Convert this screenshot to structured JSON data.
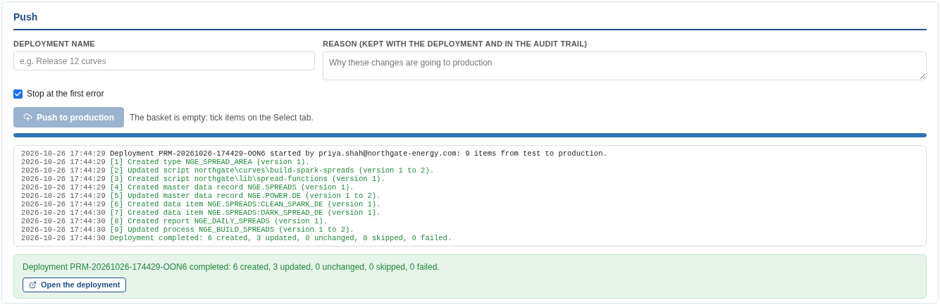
{
  "title": "Push",
  "form": {
    "name_label": "DEPLOYMENT NAME",
    "name_placeholder": "e.g. Release 12 curves",
    "reason_label": "REASON (KEPT WITH THE DEPLOYMENT AND IN THE AUDIT TRAIL)",
    "reason_placeholder": "Why these changes are going to production"
  },
  "stop_on_error": {
    "label": "Stop at the first error",
    "checked": true
  },
  "push_button": {
    "label": "Push to production",
    "disabled": true
  },
  "hint": "The basket is empty: tick items on the Select tab.",
  "progress": {
    "level": 1
  },
  "log": [
    {
      "time": "2026-10-26 17:44:29",
      "message": "Deployment PRM-20261026-174429-OON6 started by priya.shah@northgate-energy.com: 9 items from test to production.",
      "kind": "info"
    },
    {
      "time": "2026-10-26 17:44:29",
      "message": "[1] Created type NGE_SPREAD_AREA (version 1).",
      "kind": "success"
    },
    {
      "time": "2026-10-26 17:44:29",
      "message": "[2] Updated script northgate\\curves\\build-spark-spreads (version 1 to 2).",
      "kind": "success"
    },
    {
      "time": "2026-10-26 17:44:29",
      "message": "[3] Created script northgate\\lib\\spread-functions (version 1).",
      "kind": "success"
    },
    {
      "time": "2026-10-26 17:44:29",
      "message": "[4] Created master data record NGE.SPREADS (version 1).",
      "kind": "success"
    },
    {
      "time": "2026-10-26 17:44:29",
      "message": "[5] Updated master data record NGE.POWER.DE (version 1 to 2).",
      "kind": "success"
    },
    {
      "time": "2026-10-26 17:44:29",
      "message": "[6] Created data item NGE.SPREADS:CLEAN_SPARK_DE (version 1).",
      "kind": "success"
    },
    {
      "time": "2026-10-26 17:44:30",
      "message": "[7] Created data item NGE.SPREADS:DARK_SPREAD_DE (version 1).",
      "kind": "success"
    },
    {
      "time": "2026-10-26 17:44:30",
      "message": "[8] Created report NGE_DAILY_SPREADS (version 1).",
      "kind": "success"
    },
    {
      "time": "2026-10-26 17:44:30",
      "message": "[9] Updated process NGE_BUILD_SPREADS (version 1 to 2).",
      "kind": "success"
    },
    {
      "time": "2026-10-26 17:44:30",
      "message": "Deployment completed: 6 created, 3 updated, 0 unchanged, 0 skipped, 0 failed.",
      "kind": "success"
    }
  ],
  "result": {
    "message": "Deployment PRM-20261026-174429-OON6 completed: 6 created, 3 updated, 0 unchanged, 0 skipped, 0 failed.",
    "link": "Open the deployment"
  }
}
